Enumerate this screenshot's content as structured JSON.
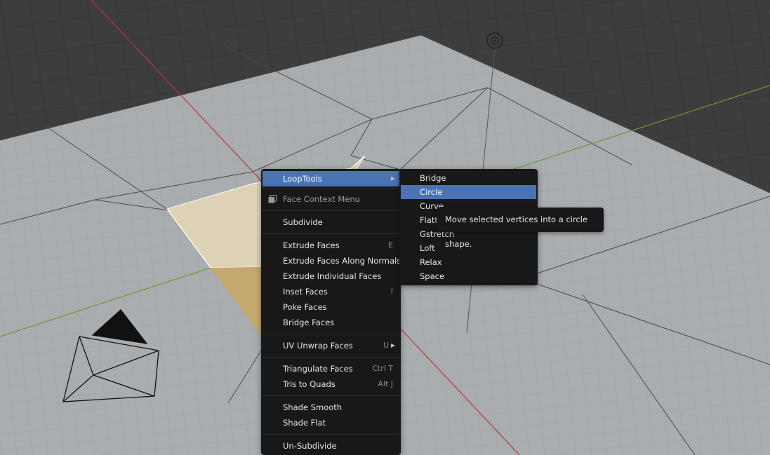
{
  "context_menu": {
    "title": "Face Context Menu",
    "loop_tools_label": "LoopTools",
    "items": {
      "subdivide": "Subdivide",
      "extrude_faces": "Extrude Faces",
      "extrude_faces_shortcut": "E",
      "extrude_along_normals": "Extrude Faces Along Normals",
      "extrude_individual": "Extrude Individual Faces",
      "inset_faces": "Inset Faces",
      "inset_faces_shortcut": "I",
      "poke_faces": "Poke Faces",
      "bridge_faces": "Bridge Faces",
      "uv_unwrap": "UV Unwrap Faces",
      "uv_unwrap_shortcut": "U",
      "triangulate": "Triangulate Faces",
      "triangulate_shortcut": "Ctrl T",
      "tris_to_quads": "Tris to Quads",
      "tris_to_quads_shortcut": "Alt J",
      "shade_smooth": "Shade Smooth",
      "shade_flat": "Shade Flat",
      "un_subdivide": "Un-Subdivide"
    }
  },
  "loop_tools_menu": {
    "items": [
      "Bridge",
      "Circle",
      "Curve",
      "Flatten",
      "Gstretch",
      "Loft",
      "Relax",
      "Space"
    ],
    "highlighted": "Circle"
  },
  "tooltip": {
    "text": "Move selected vertices into a circle shape."
  },
  "colors": {
    "accent": "#4a73b4",
    "menu_bg": "#181818",
    "floor": "#a9adb0",
    "selected_face": "#d8b878",
    "x_axis": "#b33a3a",
    "y_axis": "#6b9a2a"
  }
}
